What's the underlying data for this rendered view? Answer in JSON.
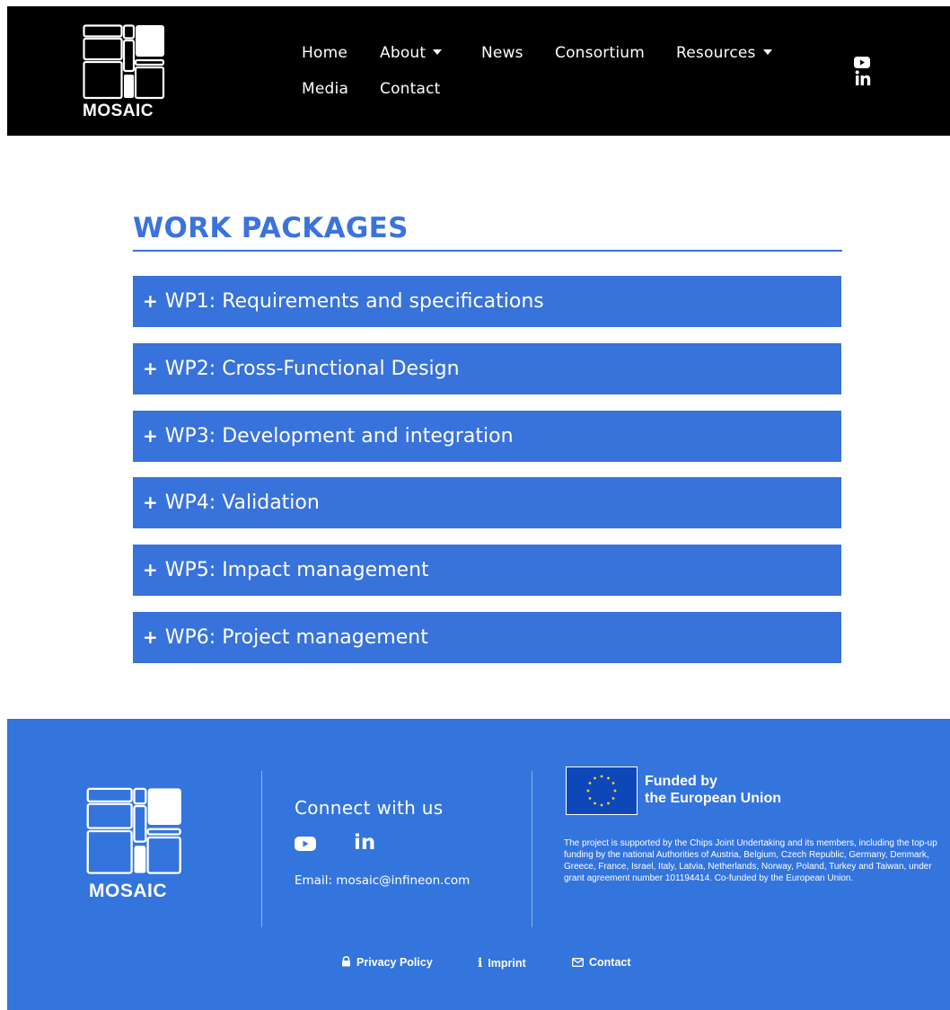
{
  "header": {
    "logo_text": "MOSAIC",
    "nav": {
      "home": "Home",
      "about": "About",
      "news": "News",
      "consortium": "Consortium",
      "resources": "Resources",
      "media": "Media",
      "contact": "Contact"
    },
    "social": [
      "youtube-icon",
      "linkedin-icon"
    ]
  },
  "main": {
    "title": "WORK PACKAGES",
    "work_packages": [
      {
        "plus": "+",
        "label": "WP1: Requirements and specifications"
      },
      {
        "plus": "+",
        "label": "WP2: Cross-Functional Design"
      },
      {
        "plus": "+",
        "label": "WP3: Development and integration"
      },
      {
        "plus": "+",
        "label": "WP4: Validation"
      },
      {
        "plus": "+",
        "label": "WP5: Impact management"
      },
      {
        "plus": "+",
        "label": "WP6: Project management"
      }
    ]
  },
  "footer": {
    "logo_text": "MOSAIC",
    "connect_title": "Connect with us",
    "linkedin_text": "in",
    "email_text": "Email: mosaic@infineon.com",
    "funded_line1": "Funded by",
    "funded_line2": "the European Union",
    "funding_statement": "The project is supported by the Chips Joint Undertaking and its members, including the top-up funding by the national Authorities of Austria, Belgium, Czech Republic, Germany, Denmark, Greece, France, Israel, Italy, Latvia, Netherlands, Norway, Poland, Turkey and Taiwan, under grant agreement number 101194414. Co-funded by the European Union.",
    "links": {
      "privacy": "Privacy Policy",
      "imprint": "Imprint",
      "contact": "Contact"
    }
  },
  "colors": {
    "header_bg": "#000000",
    "accent": "#3872db",
    "footer_bg": "#3474dd",
    "eu_blue": "#0e47b8",
    "eu_stars": "#ffd617"
  }
}
